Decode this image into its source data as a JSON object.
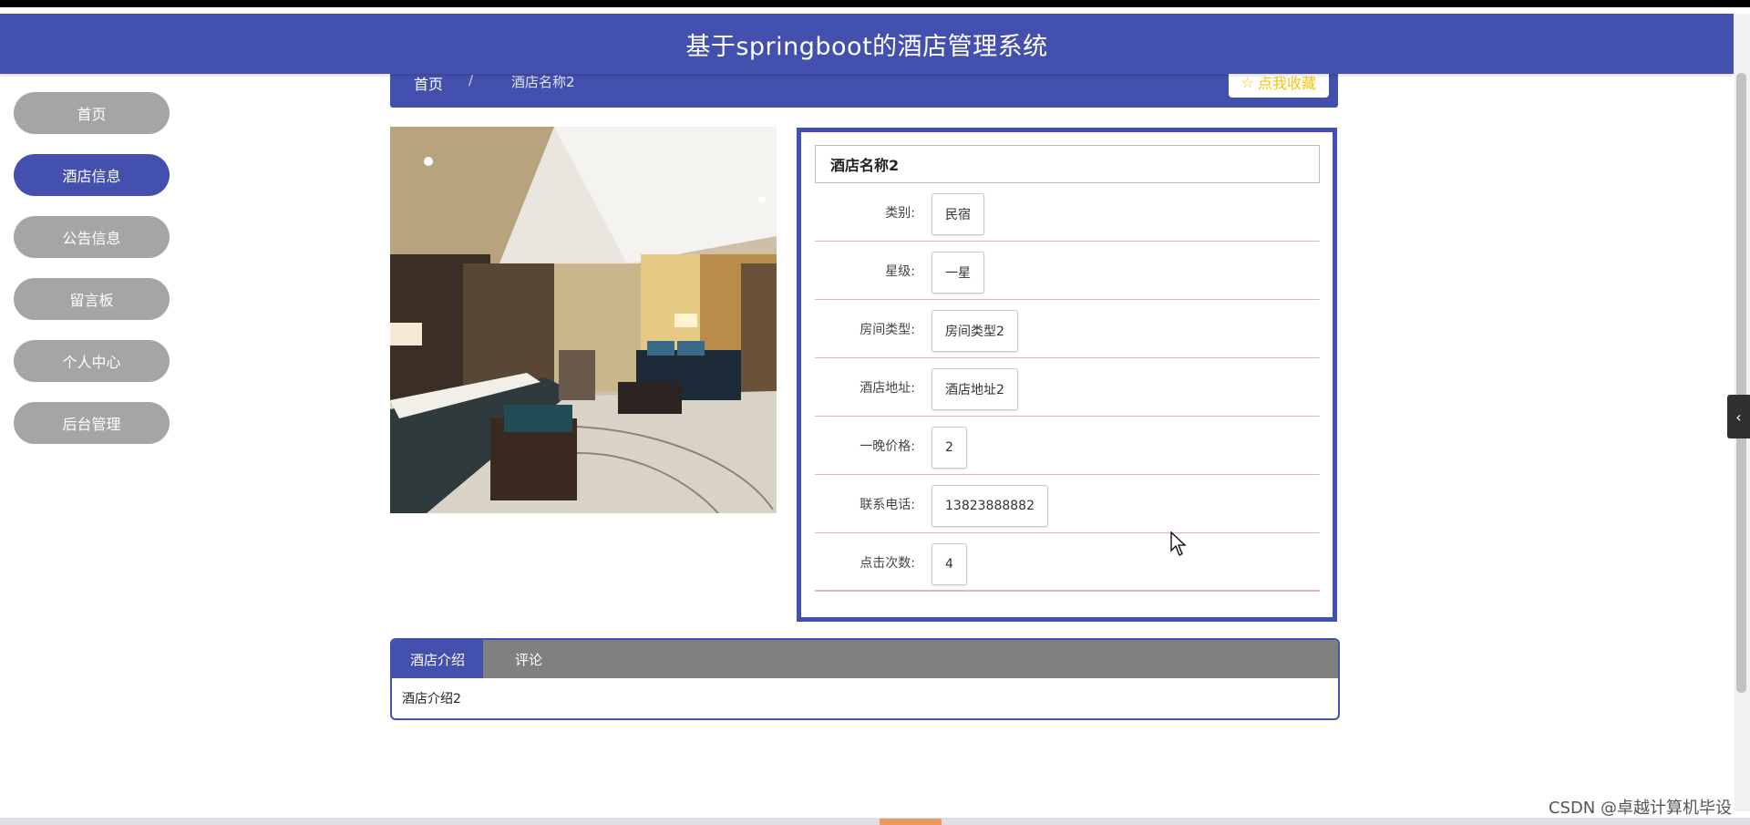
{
  "header": {
    "title": "基于springboot的酒店管理系统"
  },
  "sidebar": {
    "items": [
      {
        "label": "首页",
        "active": false
      },
      {
        "label": "酒店信息",
        "active": true
      },
      {
        "label": "公告信息",
        "active": false
      },
      {
        "label": "留言板",
        "active": false
      },
      {
        "label": "个人中心",
        "active": false
      },
      {
        "label": "后台管理",
        "active": false
      }
    ]
  },
  "breadcrumb": {
    "home": "首页",
    "separator": "/",
    "current": "酒店名称2"
  },
  "favorite": {
    "icon": "star-outline-icon",
    "label": "点我收藏"
  },
  "hotel": {
    "name": "酒店名称2",
    "fields": [
      {
        "label": "类别:",
        "value": "民宿"
      },
      {
        "label": "星级:",
        "value": "一星"
      },
      {
        "label": "房间类型:",
        "value": "房间类型2"
      },
      {
        "label": "酒店地址:",
        "value": "酒店地址2"
      },
      {
        "label": "一晚价格:",
        "value": "2"
      },
      {
        "label": "联系电话:",
        "value": "13823888882"
      },
      {
        "label": "点击次数:",
        "value": "4"
      }
    ]
  },
  "tabs": {
    "items": [
      {
        "label": "酒店介绍",
        "active": true
      },
      {
        "label": "评论",
        "active": false
      }
    ],
    "content": "酒店介绍2"
  },
  "watermark": "CSDN @卓越计算机毕设",
  "colors": {
    "primary": "#4350ad",
    "inactive": "#a5a5a5",
    "star": "#f4c20d",
    "row_line": "#e8b4c0"
  }
}
